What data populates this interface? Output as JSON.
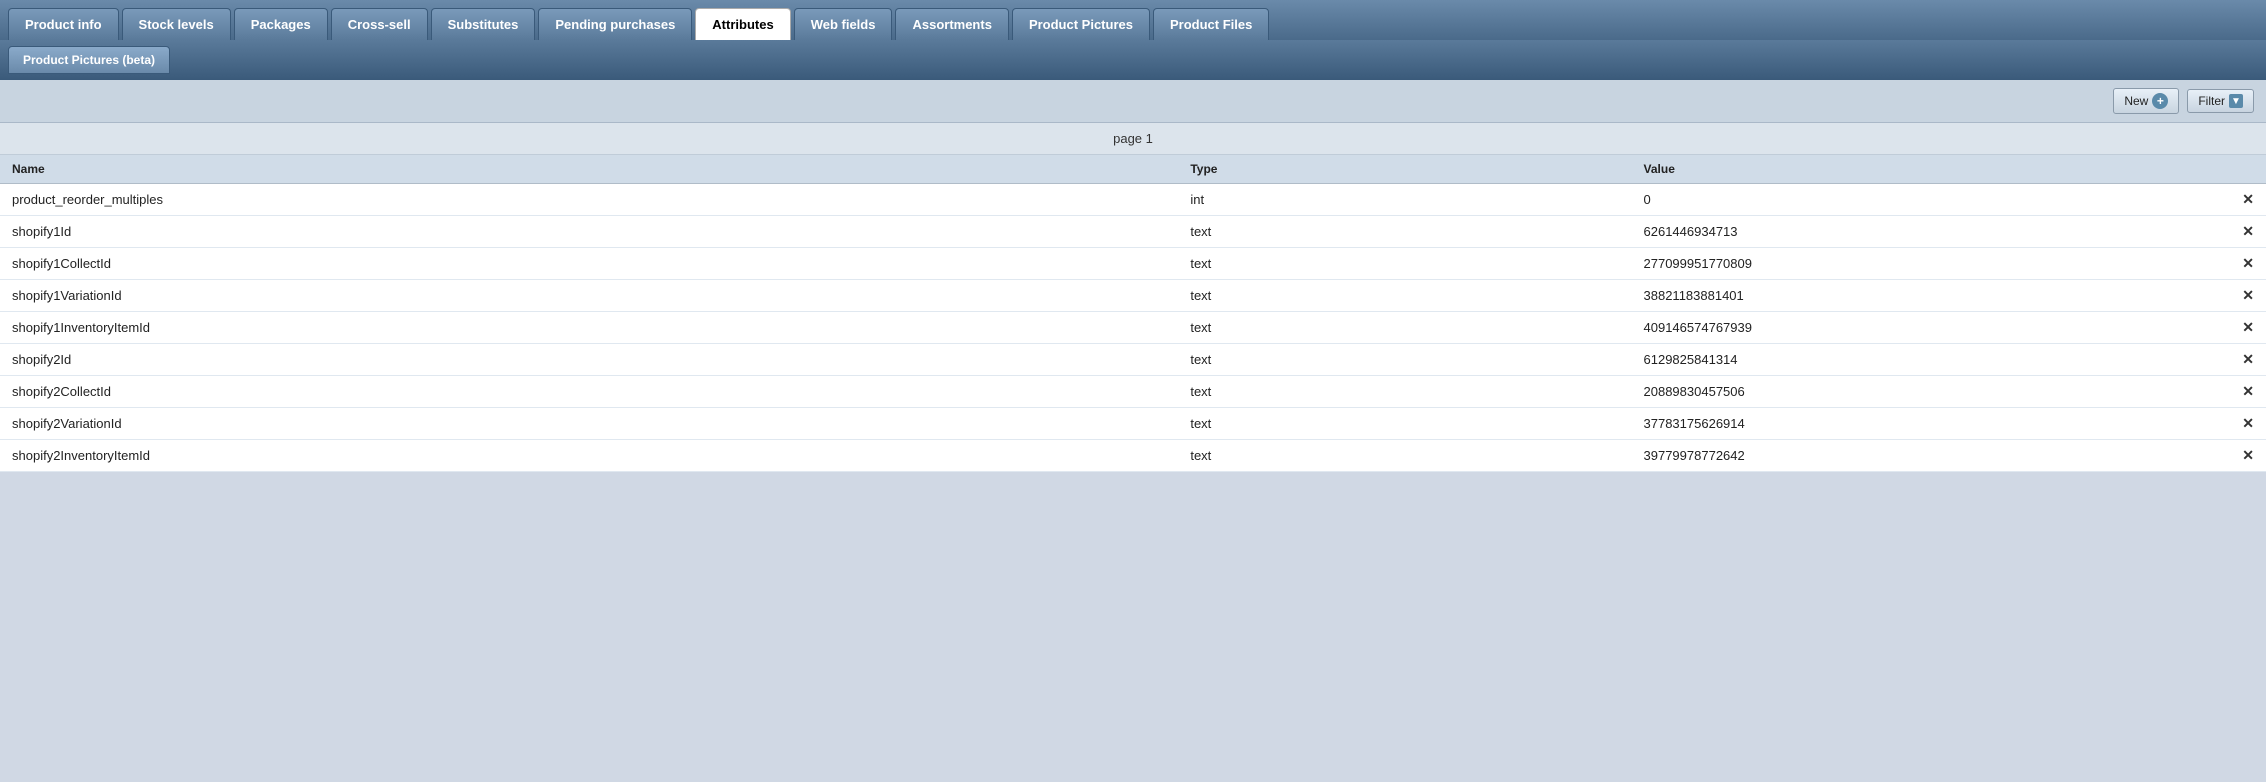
{
  "tabs": [
    {
      "label": "Product info",
      "active": false
    },
    {
      "label": "Stock levels",
      "active": false
    },
    {
      "label": "Packages",
      "active": false
    },
    {
      "label": "Cross-sell",
      "active": false
    },
    {
      "label": "Substitutes",
      "active": false
    },
    {
      "label": "Pending purchases",
      "active": false
    },
    {
      "label": "Attributes",
      "active": true
    },
    {
      "label": "Web fields",
      "active": false
    },
    {
      "label": "Assortments",
      "active": false
    },
    {
      "label": "Product Pictures",
      "active": false
    },
    {
      "label": "Product Files",
      "active": false
    }
  ],
  "sub_tabs": [
    {
      "label": "Product Pictures (beta)",
      "active": true
    }
  ],
  "toolbar": {
    "new_label": "New",
    "filter_label": "Filter"
  },
  "page_indicator": "page 1",
  "table": {
    "headers": [
      {
        "label": "Name"
      },
      {
        "label": "Type"
      },
      {
        "label": "Value"
      }
    ],
    "rows": [
      {
        "name": "product_reorder_multiples",
        "type": "int",
        "value": "0"
      },
      {
        "name": "shopify1Id",
        "type": "text",
        "value": "6261446934713"
      },
      {
        "name": "shopify1CollectId",
        "type": "text",
        "value": "277099951770809"
      },
      {
        "name": "shopify1VariationId",
        "type": "text",
        "value": "38821183881401"
      },
      {
        "name": "shopify1InventoryItemId",
        "type": "text",
        "value": "409146574767939"
      },
      {
        "name": "shopify2Id",
        "type": "text",
        "value": "6129825841314"
      },
      {
        "name": "shopify2CollectId",
        "type": "text",
        "value": "20889830457506"
      },
      {
        "name": "shopify2VariationId",
        "type": "text",
        "value": "37783175626914"
      },
      {
        "name": "shopify2InventoryItemId",
        "type": "text",
        "value": "39779978772642"
      }
    ]
  }
}
